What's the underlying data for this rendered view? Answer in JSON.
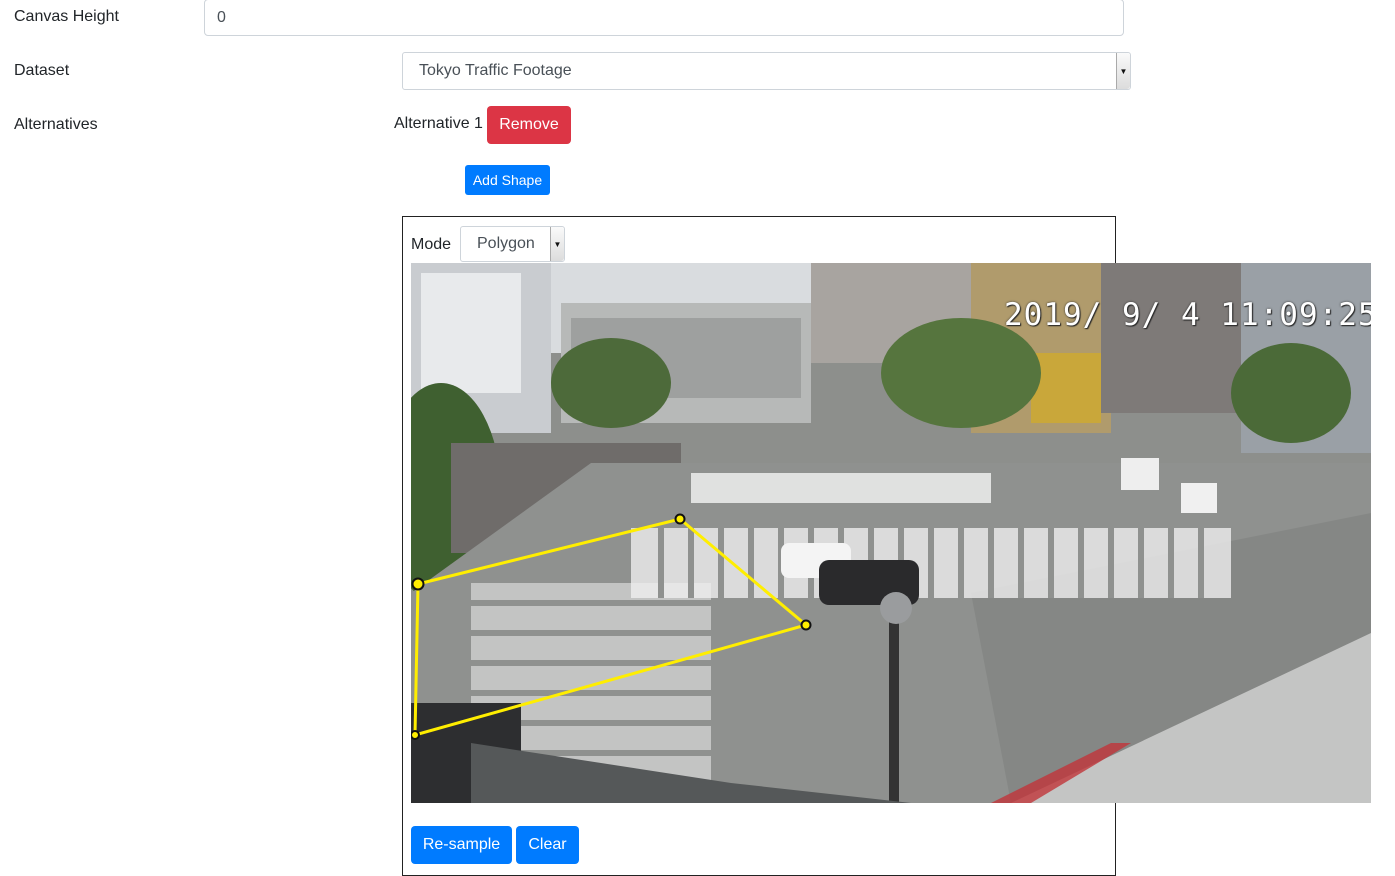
{
  "form": {
    "canvas_height": {
      "label": "Canvas Height",
      "value": "0"
    },
    "dataset": {
      "label": "Dataset",
      "selected": "Tokyo Traffic Footage"
    },
    "alternatives": {
      "label": "Alternatives",
      "item_label": "Alternative 1",
      "remove_label": "Remove",
      "add_shape_label": "Add Shape"
    }
  },
  "canvas_panel": {
    "mode_label": "Mode",
    "mode_selected": "Polygon",
    "image": {
      "description_icon": "traffic-camera-frame",
      "timestamp": "2019/ 9/ 4 11:09:25"
    },
    "polygon": {
      "stroke_color": "#ffee00",
      "vertex_count": 4
    },
    "resample_label": "Re-sample",
    "clear_label": "Clear"
  },
  "colors": {
    "primary": "#007bff",
    "danger": "#dc3545",
    "polygon": "#ffee00"
  }
}
